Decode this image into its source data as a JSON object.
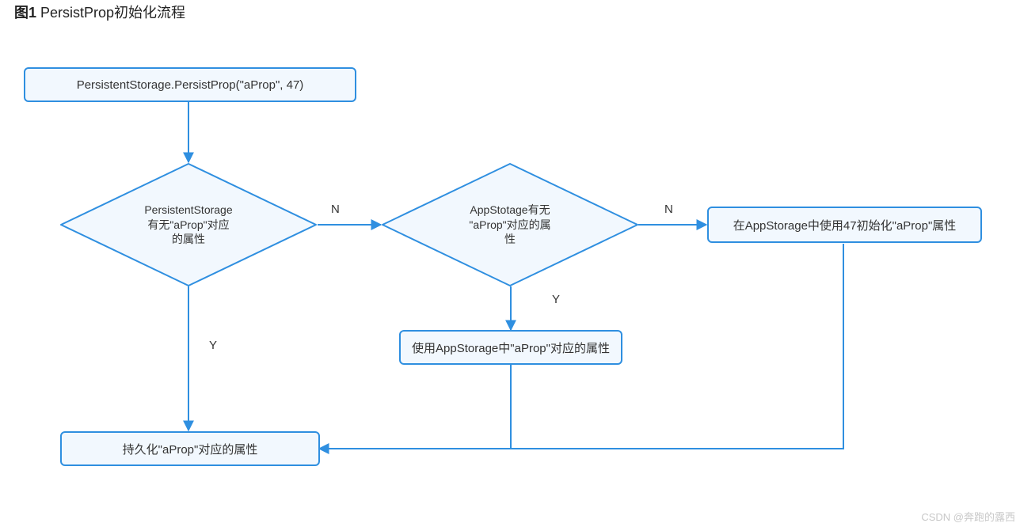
{
  "title": {
    "prefix": "图1",
    "text": " PersistProp初始化流程"
  },
  "nodes": {
    "start": "PersistentStorage.PersistProp(\"aProp\", 47)",
    "dec1": "PersistentStorage\n有无\"aProp\"对应\n的属性",
    "dec2": "AppStotage有无\n\"aProp\"对应的属\n性",
    "initApp": "在AppStorage中使用47初始化\"aProp\"属性",
    "useApp": "使用AppStorage中\"aProp\"对应的属性",
    "persist": "持久化\"aProp\"对应的属性"
  },
  "labels": {
    "yes": "Y",
    "no": "N"
  },
  "watermark": "CSDN @奔跑的露西",
  "colors": {
    "line": "#2f8fe0",
    "fill": "#f2f8fe"
  }
}
